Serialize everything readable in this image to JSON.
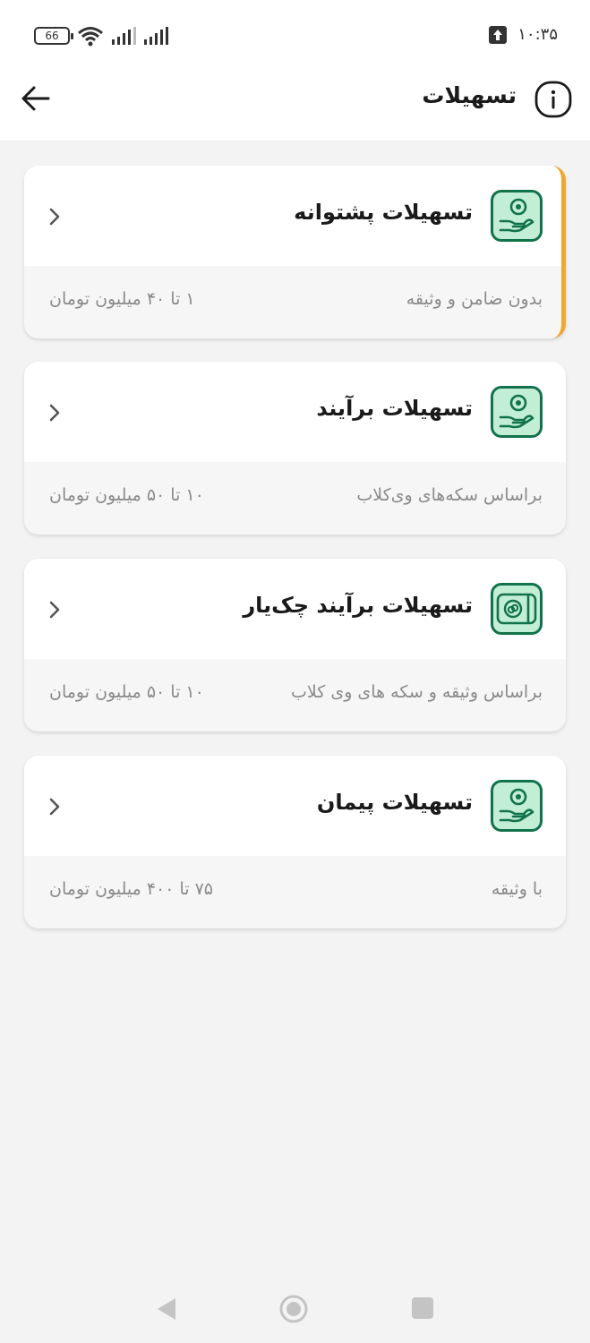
{
  "status_bar": {
    "battery": "66",
    "time": "۱۰:۳۵"
  },
  "header": {
    "title": "تسهیلات"
  },
  "cards": [
    {
      "title": "تسهیلات پشتوانه",
      "description": "بدون ضامن و وثیقه",
      "range": "۱ تا ۴۰ میلیون تومان",
      "icon": "hand-coin-icon",
      "accent": "#f2a72b"
    },
    {
      "title": "تسهیلات برآیند",
      "description": "براساس سکه‌های وی‌کلاب",
      "range": "۱۰ تا ۵۰ میلیون تومان",
      "icon": "hand-coin-icon"
    },
    {
      "title": "تسهیلات برآیند چک‌یار",
      "description": "براساس وثیقه و سکه های وی کلاب",
      "range": "۱۰ تا ۵۰ میلیون تومان",
      "icon": "cheque-coin-icon"
    },
    {
      "title": "تسهیلات پیمان",
      "description": "با وثیقه",
      "range": "۷۵ تا ۴۰۰ میلیون تومان",
      "icon": "hand-coin-icon"
    }
  ],
  "colors": {
    "icon_bg": "#c3eed6",
    "icon_stroke": "#11734b",
    "accent": "#f2a72b"
  }
}
